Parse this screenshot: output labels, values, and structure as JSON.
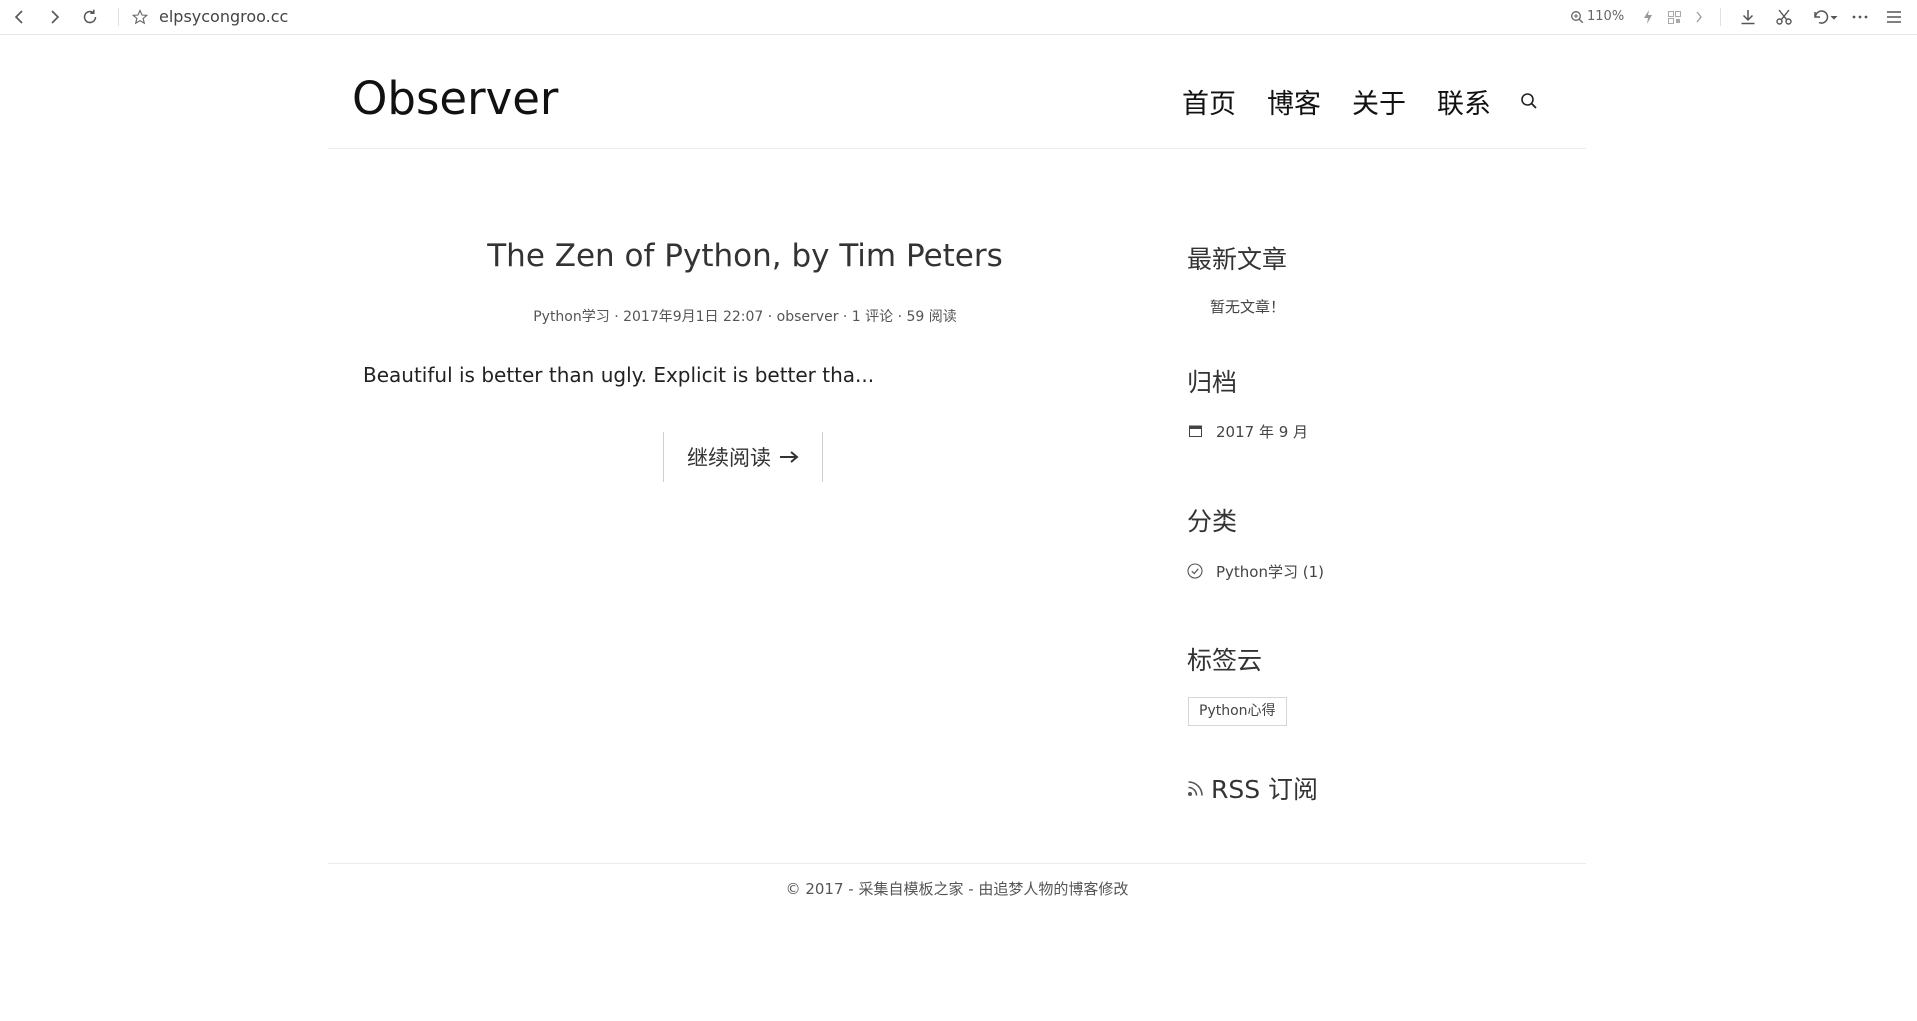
{
  "browser": {
    "url": "elpsycongroo.cc",
    "zoom": "110%"
  },
  "header": {
    "site_title": "Observer",
    "nav": [
      "首页",
      "博客",
      "关于",
      "联系"
    ]
  },
  "post": {
    "title": "The Zen of Python, by Tim Peters",
    "meta": "Python学习 · 2017年9月1日 22:07 · observer · 1 评论 · 59 阅读",
    "excerpt": "Beautiful is better than ugly. Explicit is better tha...",
    "read_more": "继续阅读"
  },
  "sidebar": {
    "latest_title": "最新文章",
    "latest_empty": "暂无文章！",
    "archive_title": "归档",
    "archive_item": "2017 年 9 月",
    "category_title": "分类",
    "category_item": "Python学习 (1)",
    "tags_title": "标签云",
    "tag_item": "Python心得",
    "rss_label": "RSS 订阅"
  },
  "footer": {
    "text": "© 2017 - 采集自模板之家 - 由追梦人物的博客修改"
  }
}
